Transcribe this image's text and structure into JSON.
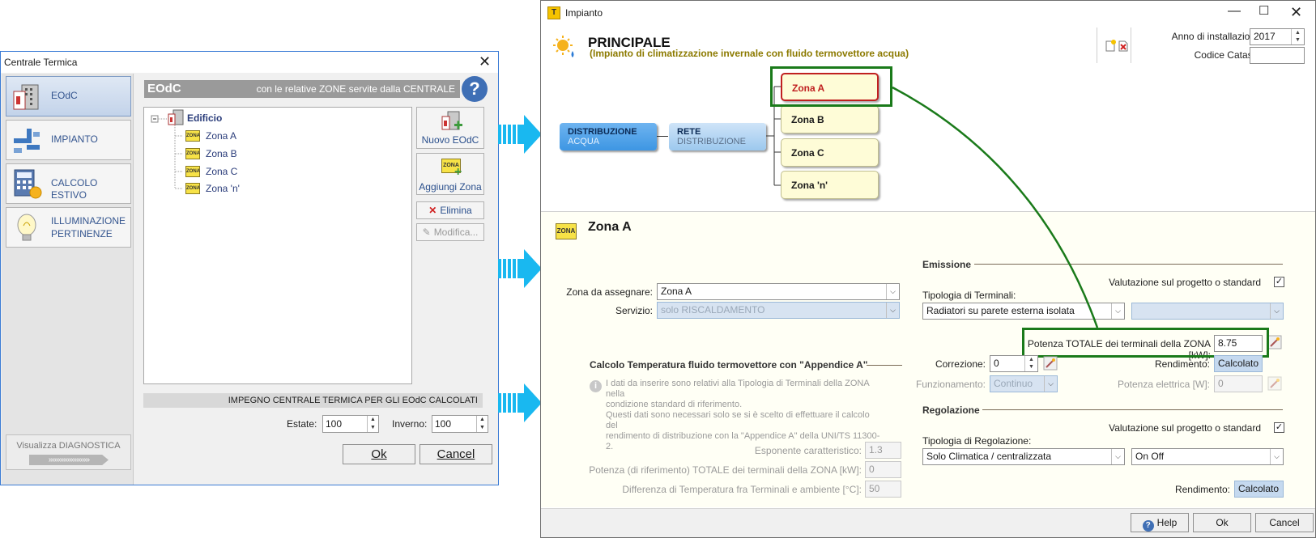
{
  "left_window": {
    "title": "Centrale Termica",
    "sidebar": [
      {
        "label": "EOdC",
        "icon": "building-icon"
      },
      {
        "label": "IMPIANTO",
        "icon": "pipes-icon"
      },
      {
        "label": "CALCOLO ESTIVO",
        "icon": "calculator-icon"
      },
      {
        "label": "ILLUMINAZIONE",
        "label2": "PERTINENZE",
        "icon": "lightbulb-icon"
      }
    ],
    "diagnostica_label": "Visualizza DIAGNOSTICA",
    "diagnostica_arrows": "»»»»»»»»»»»",
    "header_title": "EOdC",
    "header_subtitle": "con le relative ZONE servite dalla CENTRALE",
    "help_label": "?",
    "tree": {
      "root": "Edificio",
      "children": [
        "Zona A",
        "Zona B",
        "Zona C",
        "Zona 'n'"
      ],
      "zone_icon_text": "ZONA"
    },
    "buttons": {
      "nuovo": "Nuovo EOdC",
      "aggiungi": "Aggiungi Zona",
      "elimina": "Elimina",
      "modifica": "Modifica..."
    },
    "impegno_label": "IMPEGNO CENTRALE TERMICA PER GLI EOdC CALCOLATI",
    "estate_label": "Estate:",
    "estate_value": "100",
    "inverno_label": "Inverno:",
    "inverno_value": "100",
    "ok_label": "Ok",
    "cancel_label": "Cancel"
  },
  "right_window": {
    "title": "Impianto",
    "app_icon_letter": "T",
    "principale_title": "PRINCIPALE",
    "principale_subtitle": "(Impianto di climatizzazione invernale con fluido termovettore acqua)",
    "anno_label": "Anno di installazione:",
    "anno_value": "2017",
    "catasto_label": "Codice Catasto:",
    "catasto_value": "",
    "diagram": {
      "distribuzione": "DISTRIBUZIONE",
      "distribuzione_sub": "ACQUA",
      "rete": "RETE",
      "rete_sub": "DISTRIBUZIONE",
      "zones": [
        "Zona A",
        "Zona B",
        "Zona C",
        "Zona 'n'"
      ]
    },
    "zona_title": "Zona A",
    "zona_da_assegnare_label": "Zona da assegnare:",
    "zona_da_assegnare_value": "Zona A",
    "servizio_label": "Servizio:",
    "servizio_value": "solo RISCALDAMENTO",
    "calcolo_header": "Calcolo Temperatura fluido termovettore con \"Appendice A\"",
    "calcolo_note": [
      "I dati da inserire sono relativi alla Tipologia di Terminali della ZONA nella",
      "condizione standard di riferimento.",
      "Questi dati sono necessari solo se si è scelto di effettuare il calcolo del",
      "rendimento di distribuzione con la \"Appendice A\" della UNI/TS 11300-2."
    ],
    "esponente_label": "Esponente caratteristico:",
    "esponente_value": "1.3",
    "potenza_rif_label": "Potenza (di riferimento) TOTALE dei terminali della ZONA [kW]:",
    "potenza_rif_value": "0",
    "differenza_label": "Differenza di Temperatura fra Terminali e ambiente [°C]:",
    "differenza_value": "50",
    "emissione": {
      "header": "Emissione",
      "valutazione_label": "Valutazione sul progetto o standard",
      "tipologia_label": "Tipologia di Terminali:",
      "tipologia_value": "Radiatori su parete esterna isolata",
      "tipologia2_value": "",
      "potenza_totale_label": "Potenza TOTALE dei terminali della ZONA [kW]:",
      "potenza_totale_value": "8.75",
      "correzione_label": "Correzione:",
      "correzione_value": "0",
      "rendimento_label": "Rendimento:",
      "rendimento_value": "Calcolato",
      "funzionamento_label": "Funzionamento:",
      "funzionamento_value": "Continuo",
      "potenza_elettrica_label": "Potenza elettrica [W]:",
      "potenza_elettrica_value": "0"
    },
    "regolazione": {
      "header": "Regolazione",
      "valutazione_label": "Valutazione sul progetto o standard",
      "tipologia_label": "Tipologia di Regolazione:",
      "tipologia_value": "Solo Climatica / centralizzata",
      "tipo2_value": "On Off",
      "rendimento_label": "Rendimento:",
      "rendimento_value": "Calcolato"
    },
    "footer": {
      "help": "Help",
      "ok": "Ok",
      "cancel": "Cancel"
    }
  },
  "colors": {
    "accent_blue": "#3a7bd5",
    "green_highlight": "#1a7a1a",
    "arrow_cyan": "#19b8f0",
    "zone_fill": "#fefcd7",
    "subtitle_olive": "#8c7a00"
  }
}
